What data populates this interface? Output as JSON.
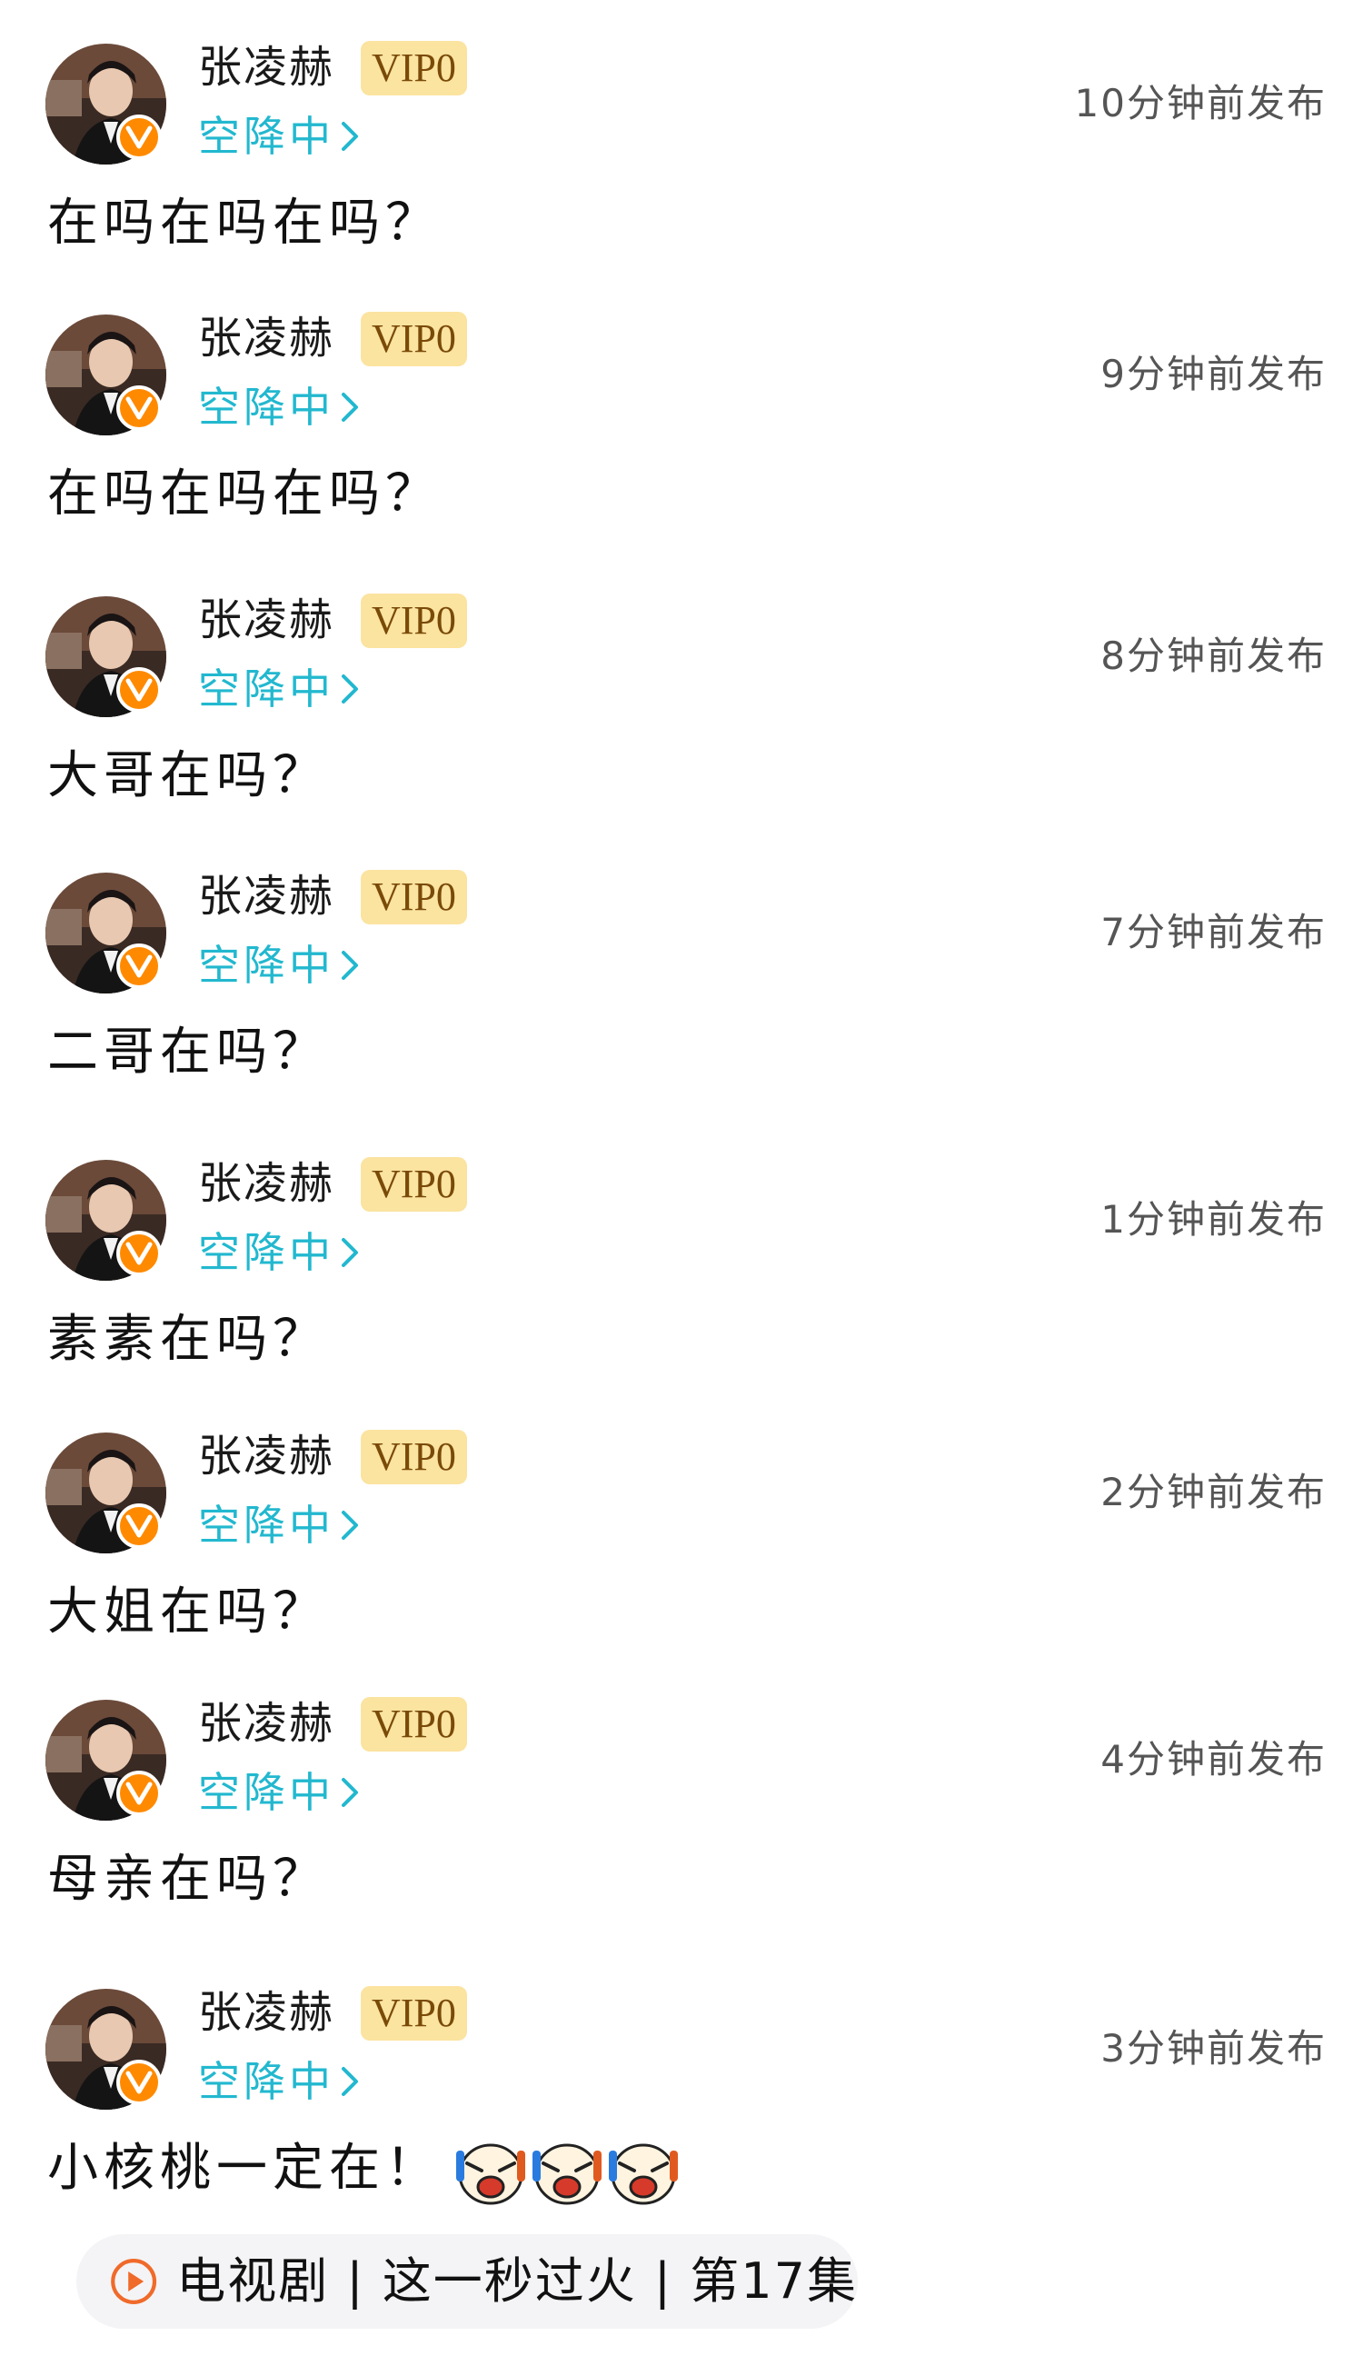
{
  "user": {
    "name": "张凌赫",
    "vip_label": "VIP0",
    "live_link": "空降中"
  },
  "posts": [
    {
      "time": "10分钟前发布",
      "message": "在吗在吗在吗？"
    },
    {
      "time": "9分钟前发布",
      "message": "在吗在吗在吗？"
    },
    {
      "time": "8分钟前发布",
      "message": "大哥在吗？"
    },
    {
      "time": "7分钟前发布",
      "message": "二哥在吗？"
    },
    {
      "time": "1分钟前发布",
      "message": "素素在吗？"
    },
    {
      "time": "2分钟前发布",
      "message": "大姐在吗？"
    },
    {
      "time": "4分钟前发布",
      "message": "母亲在吗？"
    },
    {
      "time": "3分钟前发布",
      "message": "小核桃一定在！",
      "emojis": [
        "crying-face-emoji",
        "crying-face-emoji",
        "crying-face-emoji"
      ]
    }
  ],
  "episode": {
    "label": "电视剧 | 这一秒过火 | 第17集",
    "icon": "play-circle-icon"
  },
  "colors": {
    "accent": "#22b8cf",
    "vip_bg": "#fbe3a0",
    "verified": "#ff8a00",
    "episode_icon": "#f06a2a"
  }
}
